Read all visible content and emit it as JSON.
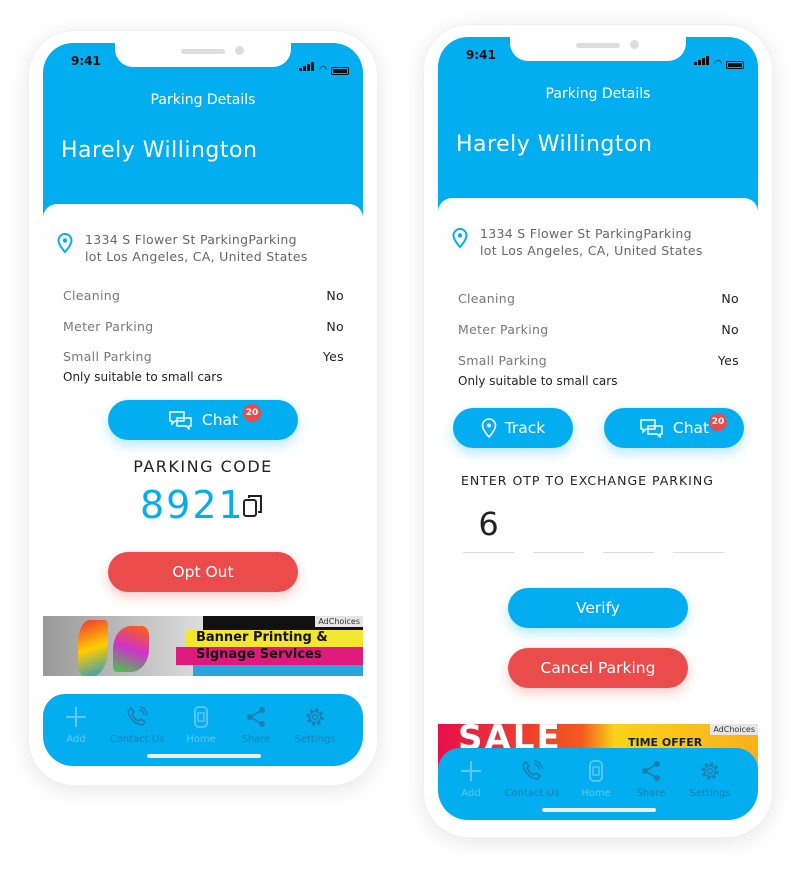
{
  "colors": {
    "primary": "#03aef0",
    "danger": "#ea4b4b"
  },
  "left_phone": {
    "status_time": "9:41",
    "header_title": "Parking Details",
    "user_name": "Harely Willington",
    "address_line1": "1334 S Flower St ParkingParking",
    "address_line2": "lot Los Angeles, CA, United States",
    "details": [
      {
        "label": "Cleaning",
        "value": "No"
      },
      {
        "label": "Meter Parking",
        "value": "No"
      },
      {
        "label": "Small Parking",
        "value": "Yes"
      }
    ],
    "note": "Only suitable to small cars",
    "chat_label": "Chat",
    "chat_badge": "20",
    "parking_code_label": "PARKING CODE",
    "parking_code": "8921",
    "opt_out_label": "Opt Out",
    "ad": {
      "text1": "Banner Printing &",
      "text2": "Signage Services",
      "adchoices": "AdChoices"
    },
    "nav": [
      {
        "label": "Add",
        "icon": "plus-icon"
      },
      {
        "label": "Contact Us",
        "icon": "phone-icon"
      },
      {
        "label": "Home",
        "icon": "car-icon"
      },
      {
        "label": "Share",
        "icon": "share-icon"
      },
      {
        "label": "Settings",
        "icon": "gear-icon"
      }
    ]
  },
  "right_phone": {
    "status_time": "9:41",
    "header_title": "Parking Details",
    "user_name": "Harely Willington",
    "address_line1": "1334 S Flower St ParkingParking",
    "address_line2": "lot Los Angeles, CA, United States",
    "details": [
      {
        "label": "Cleaning",
        "value": "No"
      },
      {
        "label": "Meter Parking",
        "value": "No"
      },
      {
        "label": "Small Parking",
        "value": "Yes"
      }
    ],
    "note": "Only suitable to small cars",
    "track_label": "Track",
    "chat_label": "Chat",
    "chat_badge": "20",
    "otp_label": "ENTER OTP TO EXCHANGE PARKING",
    "otp_digits": [
      "6",
      "",
      "",
      ""
    ],
    "verify_label": "Verify",
    "cancel_label": "Cancel Parking",
    "ad": {
      "text1": "SALE",
      "text2": "TIME OFFER",
      "adchoices": "AdChoices"
    },
    "nav": [
      {
        "label": "Add",
        "icon": "plus-icon"
      },
      {
        "label": "Contact Us",
        "icon": "phone-icon"
      },
      {
        "label": "Home",
        "icon": "car-icon"
      },
      {
        "label": "Share",
        "icon": "share-icon"
      },
      {
        "label": "Settings",
        "icon": "gear-icon"
      }
    ]
  }
}
